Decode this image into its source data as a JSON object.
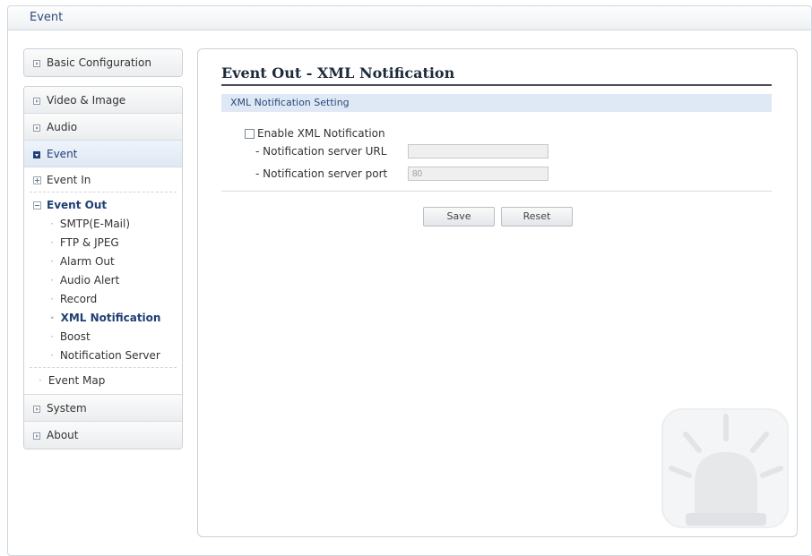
{
  "window": {
    "title": "Event"
  },
  "sidebar": {
    "basic_configuration": "Basic Configuration",
    "video_image": "Video & Image",
    "audio": "Audio",
    "event": "Event",
    "event_in": "Event In",
    "event_out": "Event Out",
    "event_out_items": [
      "SMTP(E-Mail)",
      "FTP & JPEG",
      "Alarm Out",
      "Audio Alert",
      "Record",
      "XML Notification",
      "Boost",
      "Notification Server"
    ],
    "event_map": "Event Map",
    "system": "System",
    "about": "About"
  },
  "main": {
    "title": "Event Out - XML Notification",
    "section_header": "XML Notification Setting",
    "enable_label": "Enable XML Notification",
    "enable_checked": false,
    "server_url_label": "- Notification server URL",
    "server_url_value": "",
    "server_port_label": "- Notification server port",
    "server_port_value": "80",
    "save_label": "Save",
    "reset_label": "Reset"
  },
  "colors": {
    "accent": "#1f3f75",
    "section_bg": "#dfe8f5"
  }
}
